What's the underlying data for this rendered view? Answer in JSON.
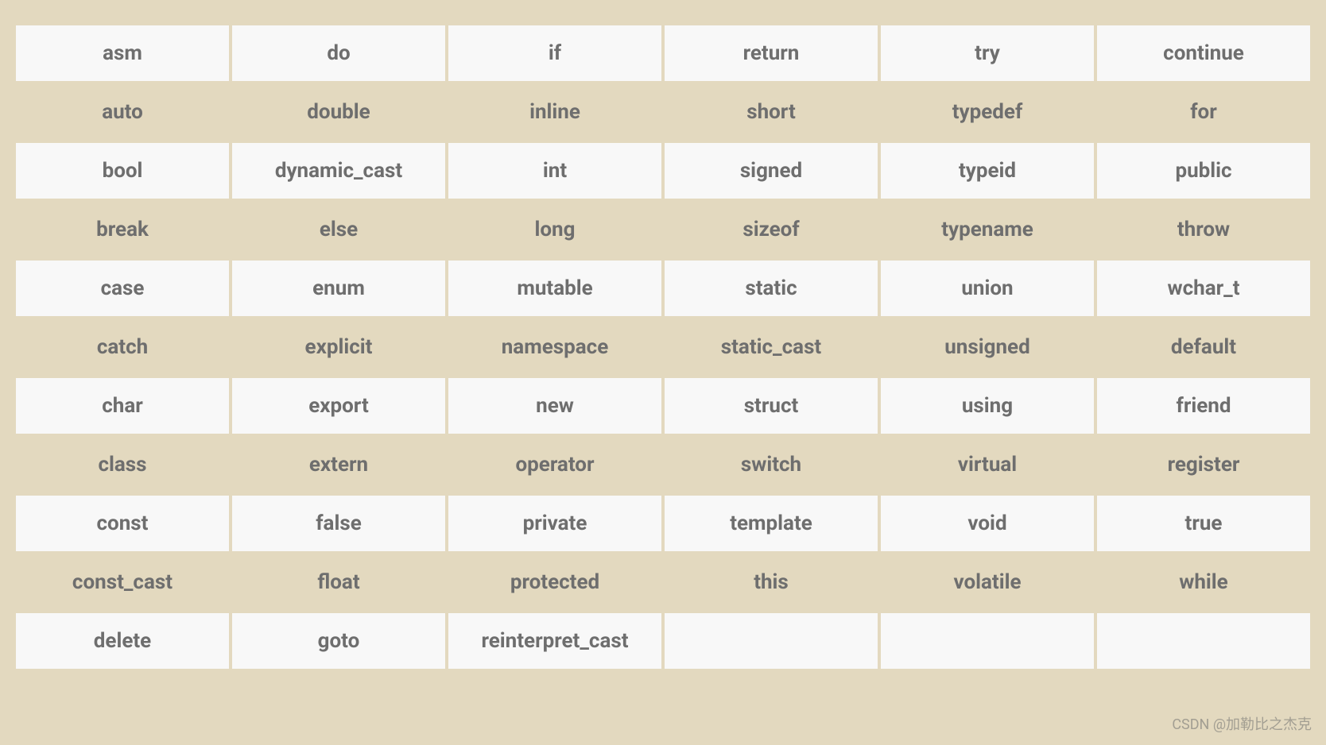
{
  "watermark": "CSDN @加勒比之杰克",
  "chart_data": {
    "type": "table",
    "title": "",
    "columns": 6,
    "rows": [
      [
        "asm",
        "do",
        "if",
        "return",
        "try",
        "continue"
      ],
      [
        "auto",
        "double",
        "inline",
        "short",
        "typedef",
        "for"
      ],
      [
        "bool",
        "dynamic_cast",
        "int",
        "signed",
        "typeid",
        "public"
      ],
      [
        "break",
        "else",
        "long",
        "sizeof",
        "typename",
        "throw"
      ],
      [
        "case",
        "enum",
        "mutable",
        "static",
        "union",
        "wchar_t"
      ],
      [
        "catch",
        "explicit",
        "namespace",
        "static_cast",
        "unsigned",
        "default"
      ],
      [
        "char",
        "export",
        "new",
        "struct",
        "using",
        "friend"
      ],
      [
        "class",
        "extern",
        "operator",
        "switch",
        "virtual",
        "register"
      ],
      [
        "const",
        "false",
        "private",
        "template",
        "void",
        "true"
      ],
      [
        "const_cast",
        "float",
        "protected",
        "this",
        "volatile",
        "while"
      ],
      [
        "delete",
        "goto",
        "reinterpret_cast",
        "",
        "",
        ""
      ]
    ]
  }
}
